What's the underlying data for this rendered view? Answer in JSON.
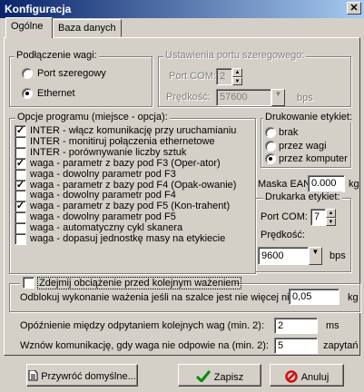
{
  "window": {
    "title": "Konfiguracja",
    "close_glyph": "✕"
  },
  "tabs": [
    {
      "label": "Ogólne",
      "active": true
    },
    {
      "label": "Baza danych",
      "active": false
    }
  ],
  "connection": {
    "legend": "Podłączenie wagi:",
    "serial_label": "Port szeregowy",
    "ethernet_label": "Ethernet",
    "selected": "Ethernet"
  },
  "serial_settings": {
    "legend": "Ustawienia portu szeregowego:",
    "port_label": "Port COM:",
    "port_value": "2",
    "speed_label": "Prędkość:",
    "speed_value": "57600",
    "speed_unit": "bps"
  },
  "options": {
    "legend": "Opcje programu (miejsce - opcja):",
    "items": [
      {
        "label": "INTER - włącz komunikację przy uruchamianiu",
        "checked": true
      },
      {
        "label": "INTER - monitiruj połączenia ethernetowe",
        "checked": false
      },
      {
        "label": "INTER - porównywanie liczby sztuk",
        "checked": false
      },
      {
        "label": "waga - parametr z bazy pod F3 (Oper-ator)",
        "checked": true
      },
      {
        "label": "waga - dowolny parametr pod F3",
        "checked": false
      },
      {
        "label": "waga - parametr z bazy pod F4 (Opak-owanie)",
        "checked": true
      },
      {
        "label": "waga - dowolny parametr pod F4",
        "checked": false
      },
      {
        "label": "waga - parametr z bazy pod F5 (Kon-trahent)",
        "checked": true
      },
      {
        "label": "waga - dowolny parametr pod F5",
        "checked": false
      },
      {
        "label": "waga - automatyczny cykl skanera",
        "checked": false
      },
      {
        "label": "waga - dopasuj jednostkę masy na etykiecie",
        "checked": false
      }
    ]
  },
  "label_printing": {
    "legend": "Drukowanie etykiet:",
    "none_label": "brak",
    "scale_label": "przez wagi",
    "computer_label": "przez komputer",
    "selected": "przez komputer"
  },
  "ean": {
    "label": "Maska EAN:",
    "value": "0.000",
    "unit": "kg"
  },
  "label_printer": {
    "legend": "Drukarka etykiet:",
    "port_label": "Port COM:",
    "port_value": "7",
    "speed_label": "Prędkość:",
    "speed_value": "9600",
    "speed_unit": "bps"
  },
  "tare": {
    "checkbox_label": "Zdejmij obciążenie przed kolejnym ważeniem",
    "checked": false,
    "unlock_label": "Odblokuj wykonanie ważenia jeśli na szalce jest nie więcej niż",
    "unlock_value": "0,05",
    "unlock_unit": "kg"
  },
  "delay": {
    "label": "Opóźnienie między odpytaniem kolejnych wag (min. 2):",
    "value": "2",
    "unit": "ms"
  },
  "retry": {
    "label": "Wznów komunikację, gdy waga nie odpowie na (min. 2):",
    "value": "5",
    "unit": "zapytań"
  },
  "buttons": {
    "restore": "Przywróć domyślne...",
    "save": "Zapisz",
    "cancel": "Anuluj"
  },
  "colors": {
    "title_bar_start": "#0a246a",
    "title_bar_end": "#a6caf0",
    "save_check": "#0a8a0a",
    "cancel_icon": "#d01010"
  }
}
